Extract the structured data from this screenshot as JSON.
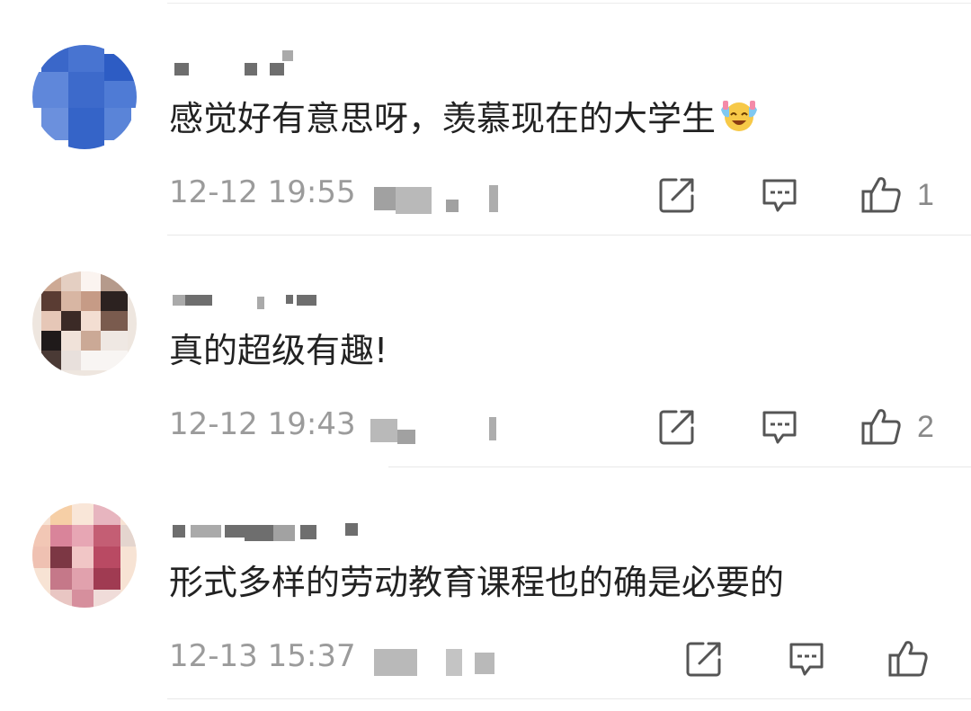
{
  "comments": [
    {
      "text": "感觉好有意思呀，羡慕现在的大学生",
      "emoji": "laughing-crying-emoji",
      "timestamp": "12-12 19:55",
      "likes": "1",
      "avatar_colors": [
        "#3f6fcf",
        "#2a5bc6",
        "#4a78d4",
        "#6e93e0"
      ]
    },
    {
      "text": "真的超级有趣!",
      "timestamp": "12-12 19:43",
      "likes": "2",
      "avatar_colors": [
        "#d9b6a2",
        "#3a2a25",
        "#f1e6df",
        "#c7a38f"
      ]
    },
    {
      "text": "形式多样的劳动教育课程也的确是必要的",
      "timestamp": "12-13 15:37",
      "likes": "",
      "avatar_colors": [
        "#e2a8b3",
        "#c96e7f",
        "#f4d6b6",
        "#b0485d"
      ]
    }
  ],
  "icons": {
    "share": "share-icon",
    "reply": "comment-icon",
    "like": "thumbs-up-icon"
  }
}
